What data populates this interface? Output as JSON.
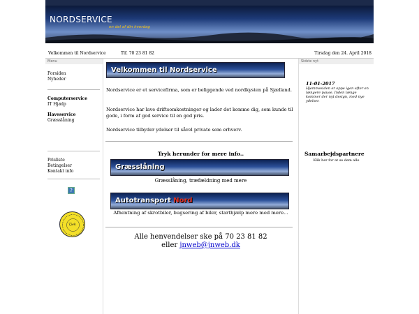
{
  "header": {
    "title": "NORDSERVICE",
    "subtitle": "en del af din hverdag"
  },
  "infobar": {
    "welcome": "Velkommen til Nordservice",
    "phone": "Tlf. 70 23 81 82",
    "date": "Tirsdag den 24. April 2018"
  },
  "sidebar": {
    "header": "Menu",
    "group1": [
      "Forsiden",
      "Nyheder"
    ],
    "group2_title": "Computerservice",
    "group2": [
      "IT Hjælp"
    ],
    "group3_title": "Haveservice",
    "group3": [
      "Græsslåning"
    ],
    "group4": [
      "Prisliste",
      "Betingelser",
      "Kontakt info"
    ],
    "help_glyph": "?",
    "seal_text": "Tjek"
  },
  "main": {
    "heading": "Velkommen til Nordservice",
    "para1": "Nordservice er et servicefirma, som er beliggende ved nordkysten på Sjælland.",
    "para2": "Nordservice har lave driftsomkostninger og lader det komme dig, som kunde til gode, i form af god service til en god pris.",
    "para3": "Nordservice tilbyder ydelser til såvel private som erhverv.",
    "more_info": "Tryk herunder for mere info..",
    "service1_title": "Græsslåning",
    "service1_desc": "Græsslåning, træfældning med mere",
    "service2_title_a": "Autotransport",
    "service2_title_b": "Nord",
    "service2_desc": "Afhentning af skrotbiler, bugsering af biler, starthjælp mere med mere...",
    "contact_line1": "Alle henvendelser ske på 70 23 81 82",
    "contact_line2_prefix": "eller ",
    "contact_email": "jnweb@jnweb.dk"
  },
  "rightbar": {
    "header": "Sidste nyt",
    "news_date": "11-01-2017",
    "news_text": "Hjemmesiden er oppe igen efter en længere pause. Inden længe kommer der nyt design, med nye ydelser.",
    "partners_title": "Samarbejdspartnere",
    "partners_link": "Klik her for at se dem alle"
  },
  "colors": {
    "banner_dark": "#0c1a3a",
    "banner_light": "#6f8fc8",
    "accent_yellow": "#f5c518",
    "accent_red": "#e03020",
    "link": "#0000cc"
  },
  "icons": {
    "help": "help-icon",
    "seal": "quality-seal-icon"
  }
}
